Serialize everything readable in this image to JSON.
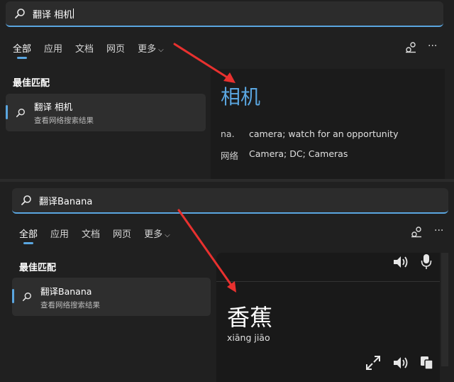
{
  "panel1": {
    "search_query": "翻译 相机",
    "tabs": [
      {
        "label": "全部"
      },
      {
        "label": "应用"
      },
      {
        "label": "文档"
      },
      {
        "label": "网页"
      },
      {
        "label": "更多"
      }
    ],
    "best_match_label": "最佳匹配",
    "result_title": "翻译 相机",
    "result_subtitle": "查看网络搜索结果",
    "translation": {
      "word": "相机",
      "defs": [
        {
          "pos": "na.",
          "text": "camera; watch for an opportunity"
        },
        {
          "pos": "网络",
          "text": "Camera; DC; Cameras"
        }
      ]
    }
  },
  "panel2": {
    "search_query": "翻译Banana",
    "tabs": [
      {
        "label": "全部"
      },
      {
        "label": "应用"
      },
      {
        "label": "文档"
      },
      {
        "label": "网页"
      },
      {
        "label": "更多"
      }
    ],
    "best_match_label": "最佳匹配",
    "result_title": "翻译Banana",
    "result_subtitle": "查看网络搜索结果",
    "translation": {
      "word": "香蕉",
      "pinyin": "xiāng jiāo"
    }
  },
  "icons": {
    "search": "search-icon",
    "share": "share-icon",
    "more": "more-icon",
    "speaker": "speaker-icon",
    "mic": "microphone-icon",
    "expand": "expand-icon",
    "copy": "copy-icon"
  },
  "colors": {
    "accent": "#5aa6e0",
    "annotation_arrow": "#e8312f"
  }
}
